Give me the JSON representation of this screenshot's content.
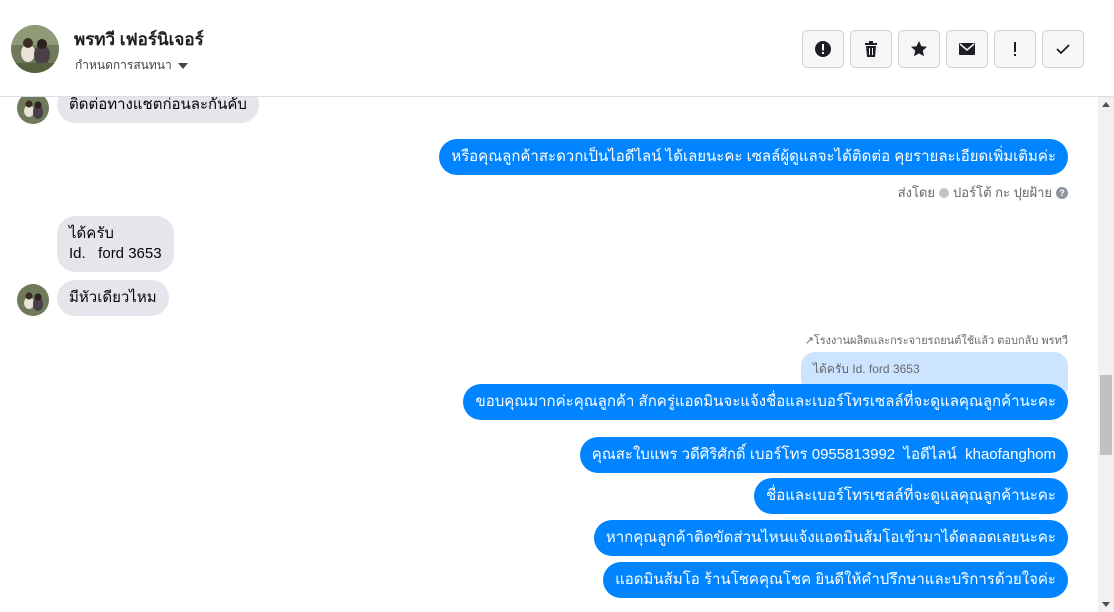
{
  "contact": {
    "name": "พรทวี เฟอร์นิเจอร์",
    "settings_label": "กำหนดการสนทนา"
  },
  "toolbar": [
    {
      "name": "report-button",
      "icon": "alert-circle-icon"
    },
    {
      "name": "delete-button",
      "icon": "trash-icon"
    },
    {
      "name": "star-button",
      "icon": "star-icon"
    },
    {
      "name": "mark-unread-button",
      "icon": "envelope-icon"
    },
    {
      "name": "important-button",
      "icon": "exclamation-icon"
    },
    {
      "name": "mark-done-button",
      "icon": "checkmark-icon"
    }
  ],
  "messages": {
    "in_1": "ติดต่อทางแชตก่อนละกันคับ",
    "out_1": "หรือคุณลูกค้าสะดวกเป็นไอดีไลน์ ได้เลยนะคะ เซลล์ผู้ดูแลจะได้ติดต่อ คุยรายละเอียดเพิ่มเติมค่ะ",
    "sent_by_prefix": "ส่งโดย",
    "sent_by_name": "ปอร์โต้ กะ ปุยฝ้าย",
    "in_2_line1": "ได้ครับ",
    "in_2_line2": "Id.   ford 3653",
    "in_3": "มีหัวเดียวไหม",
    "reply_label": "โรงงานผลิตและกระจายรถยนต์ใช้แล้ว ตอบกลับ พรทวี",
    "reply_quote": "ได้ครับ Id. ford 3653",
    "out_2": "ขอบคุณมากค่ะคุณลูกค้า สักครู่แอดมินจะแจ้งชื่อและเบอร์โทรเซลล์ที่จะดูแลคุณลูกค้านะคะ",
    "out_3": "คุณสะใบแพร วดีศิริศักดิ์ เบอร์โทร 0955813992  ไอดีไลน์  khaofanghom",
    "out_4": "ชื่อและเบอร์โทรเซลล์ที่จะดูแลคุณลูกค้านะคะ",
    "out_5": "หากคุณลูกค้าติดขัดส่วนไหนแจ้งแอดมินส้มโอเข้ามาได้ตลอดเลยนะคะ",
    "out_6": "แอดมินส้มโอ ร้านโชคคุณโชค ยินดีให้คำปรึกษาและบริการด้วยใจค่ะ"
  },
  "colors": {
    "outgoing": "#0084ff",
    "incoming": "#e4e6eb",
    "reply_quote": "#cce4ff"
  }
}
